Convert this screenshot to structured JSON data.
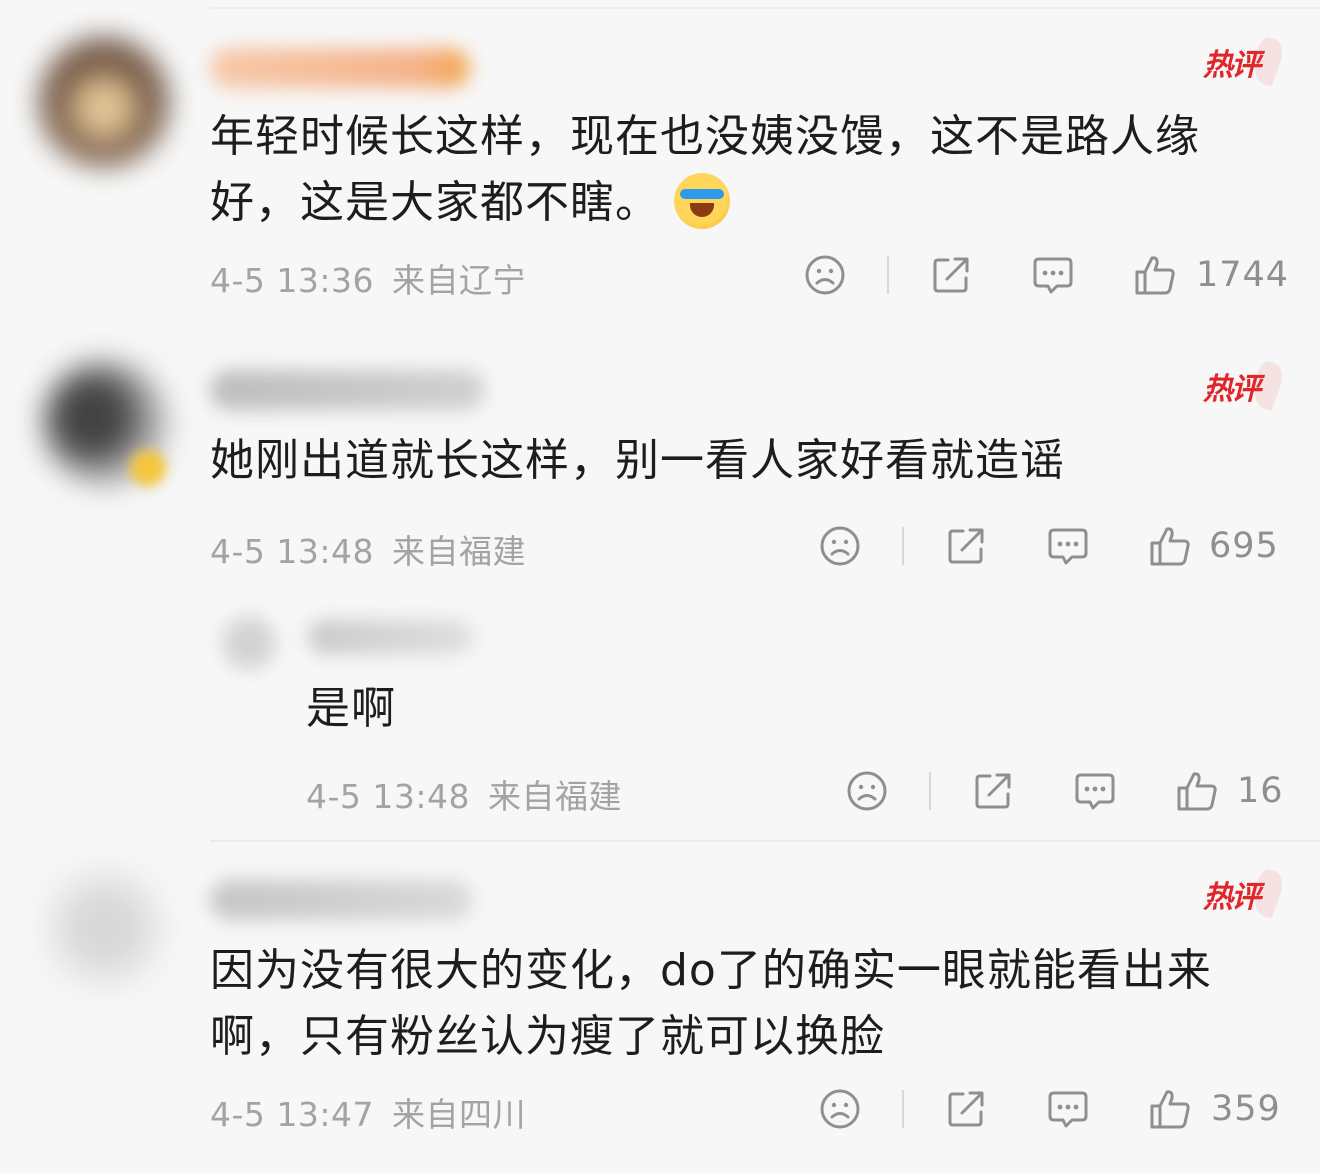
{
  "colors": {
    "hot_red": "#e0262b",
    "meta_gray": "#a3a3a3",
    "icon_gray": "#8f8f8f",
    "text": "#1d1d1d"
  },
  "comments": [
    {
      "username": "",
      "hot_badge": "热评",
      "text_line1": "年轻时候长这样，现在也没姨没馒，这不是路人缘",
      "text_line2": "好，这是大家都不瞎。",
      "emoji": "laughing-crying-emoji",
      "timestamp": "4-5 13:36",
      "location": "来自辽宁",
      "likes": "1744"
    },
    {
      "username": "",
      "hot_badge": "热评",
      "text_line1": "她刚出道就长这样，别一看人家好看就造谣",
      "timestamp": "4-5 13:48",
      "location": "来自福建",
      "likes": "695"
    },
    {
      "username": "",
      "text_line1": "是啊",
      "timestamp": "4-5 13:48",
      "location": "来自福建",
      "likes": "16"
    },
    {
      "username": "",
      "hot_badge": "热评",
      "text_line1": "因为没有很大的变化，do了的确实一眼就能看出来",
      "text_line2": "啊，只有粉丝认为瘦了就可以换脸",
      "timestamp": "4-5 13:47",
      "location": "来自四川",
      "likes": "359"
    }
  ],
  "icons": {
    "dislike": "frown-icon",
    "share": "share-icon",
    "reply": "reply-bubble-icon",
    "like": "thumbs-up-icon"
  }
}
